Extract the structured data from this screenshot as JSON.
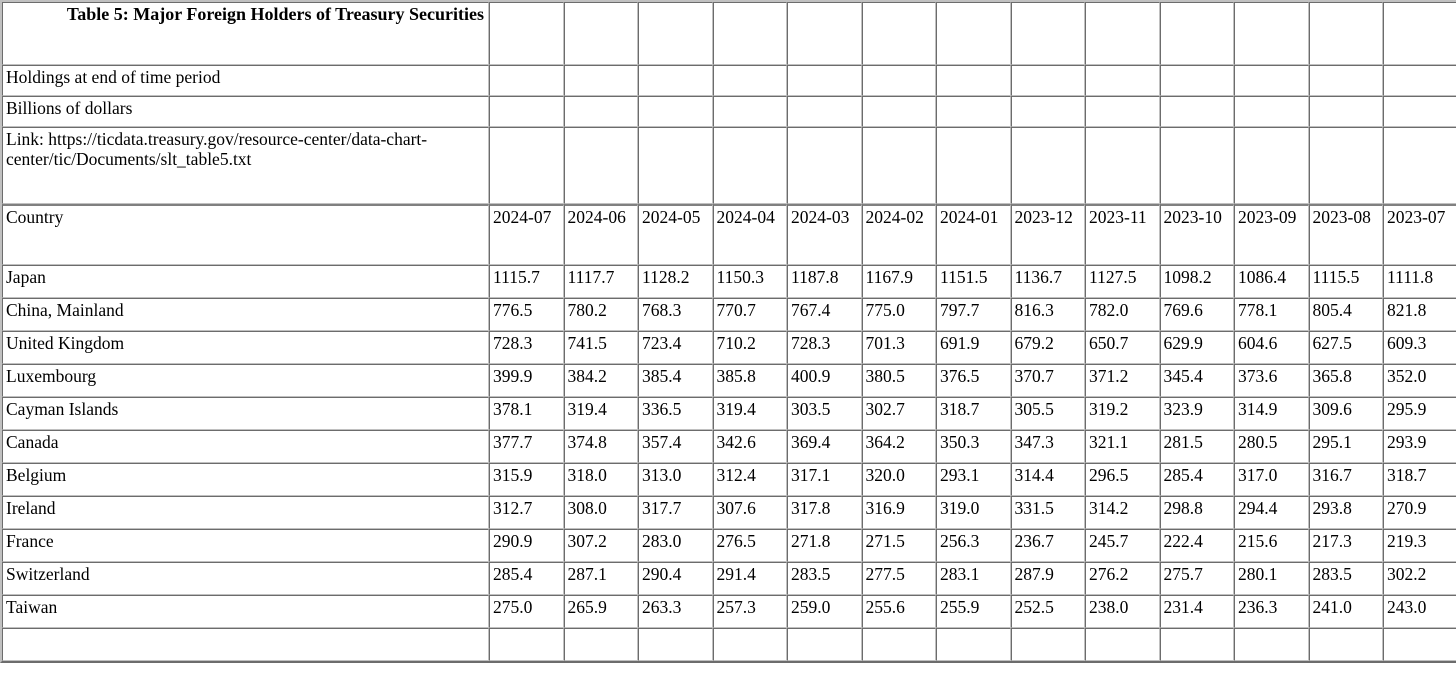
{
  "document": {
    "title": "Table 5: Major Foreign Holders of Treasury Securities",
    "subtitle_1": "Holdings at end of time period",
    "subtitle_2": "Billions of dollars",
    "link_line": "Link: https://ticdata.treasury.gov/resource-center/data-chart-center/tic/Documents/slt_table5.txt"
  },
  "chart_data": {
    "type": "table",
    "title": "Table 5: Major Foreign Holders of Treasury Securities",
    "subtitle": "Holdings at end of time period",
    "units": "Billions of dollars",
    "source_link": "https://ticdata.treasury.gov/resource-center/data-chart-center/tic/Documents/slt_table5.txt",
    "row_header": "Country",
    "categories": [
      "2024-07",
      "2024-06",
      "2024-05",
      "2024-04",
      "2024-03",
      "2024-02",
      "2024-01",
      "2023-12",
      "2023-11",
      "2023-10",
      "2023-09",
      "2023-08",
      "2023-07"
    ],
    "series": [
      {
        "name": "Japan",
        "values": [
          1115.7,
          1117.7,
          1128.2,
          1150.3,
          1187.8,
          1167.9,
          1151.5,
          1136.7,
          1127.5,
          1098.2,
          1086.4,
          1115.5,
          1111.8
        ]
      },
      {
        "name": "China, Mainland",
        "values": [
          776.5,
          780.2,
          768.3,
          770.7,
          767.4,
          775.0,
          797.7,
          816.3,
          782.0,
          769.6,
          778.1,
          805.4,
          821.8
        ]
      },
      {
        "name": "United Kingdom",
        "values": [
          728.3,
          741.5,
          723.4,
          710.2,
          728.3,
          701.3,
          691.9,
          679.2,
          650.7,
          629.9,
          604.6,
          627.5,
          609.3
        ]
      },
      {
        "name": "Luxembourg",
        "values": [
          399.9,
          384.2,
          385.4,
          385.8,
          400.9,
          380.5,
          376.5,
          370.7,
          371.2,
          345.4,
          373.6,
          365.8,
          352.0
        ]
      },
      {
        "name": "Cayman Islands",
        "values": [
          378.1,
          319.4,
          336.5,
          319.4,
          303.5,
          302.7,
          318.7,
          305.5,
          319.2,
          323.9,
          314.9,
          309.6,
          295.9
        ]
      },
      {
        "name": "Canada",
        "values": [
          377.7,
          374.8,
          357.4,
          342.6,
          369.4,
          364.2,
          350.3,
          347.3,
          321.1,
          281.5,
          280.5,
          295.1,
          293.9
        ]
      },
      {
        "name": "Belgium",
        "values": [
          315.9,
          318.0,
          313.0,
          312.4,
          317.1,
          320.0,
          293.1,
          314.4,
          296.5,
          285.4,
          317.0,
          316.7,
          318.7
        ]
      },
      {
        "name": "Ireland",
        "values": [
          312.7,
          308.0,
          317.7,
          307.6,
          317.8,
          316.9,
          319.0,
          331.5,
          314.2,
          298.8,
          294.4,
          293.8,
          270.9
        ]
      },
      {
        "name": "France",
        "values": [
          290.9,
          307.2,
          283.0,
          276.5,
          271.8,
          271.5,
          256.3,
          236.7,
          245.7,
          222.4,
          215.6,
          217.3,
          219.3
        ]
      },
      {
        "name": "Switzerland",
        "values": [
          285.4,
          287.1,
          290.4,
          291.4,
          283.5,
          277.5,
          283.1,
          287.9,
          276.2,
          275.7,
          280.1,
          283.5,
          302.2
        ]
      },
      {
        "name": "Taiwan",
        "values": [
          275.0,
          265.9,
          263.3,
          257.3,
          259.0,
          255.6,
          255.9,
          252.5,
          238.0,
          231.4,
          236.3,
          241.0,
          243.0
        ]
      }
    ],
    "ylabel": "Billions of dollars",
    "xlabel": "",
    "grid": true,
    "legend": "none"
  },
  "columns": {
    "row_header": "Country",
    "months": [
      "2024-07",
      "2024-06",
      "2024-05",
      "2024-04",
      "2024-03",
      "2024-02",
      "2024-01",
      "2023-12",
      "2023-11",
      "2023-10",
      "2023-09",
      "2023-08",
      "2023-07"
    ]
  },
  "rows": [
    {
      "country": "Japan",
      "values": [
        "1115.7",
        "1117.7",
        "1128.2",
        "1150.3",
        "1187.8",
        "1167.9",
        "1151.5",
        "1136.7",
        "1127.5",
        "1098.2",
        "1086.4",
        "1115.5",
        "1111.8"
      ]
    },
    {
      "country": "China, Mainland",
      "values": [
        "776.5",
        "780.2",
        "768.3",
        "770.7",
        "767.4",
        "775.0",
        "797.7",
        "816.3",
        "782.0",
        "769.6",
        "778.1",
        "805.4",
        "821.8"
      ]
    },
    {
      "country": "United Kingdom",
      "values": [
        "728.3",
        "741.5",
        "723.4",
        "710.2",
        "728.3",
        "701.3",
        "691.9",
        "679.2",
        "650.7",
        "629.9",
        "604.6",
        "627.5",
        "609.3"
      ]
    },
    {
      "country": "Luxembourg",
      "values": [
        "399.9",
        "384.2",
        "385.4",
        "385.8",
        "400.9",
        "380.5",
        "376.5",
        "370.7",
        "371.2",
        "345.4",
        "373.6",
        "365.8",
        "352.0"
      ]
    },
    {
      "country": "Cayman Islands",
      "values": [
        "378.1",
        "319.4",
        "336.5",
        "319.4",
        "303.5",
        "302.7",
        "318.7",
        "305.5",
        "319.2",
        "323.9",
        "314.9",
        "309.6",
        "295.9"
      ]
    },
    {
      "country": "Canada",
      "values": [
        "377.7",
        "374.8",
        "357.4",
        "342.6",
        "369.4",
        "364.2",
        "350.3",
        "347.3",
        "321.1",
        "281.5",
        "280.5",
        "295.1",
        "293.9"
      ]
    },
    {
      "country": "Belgium",
      "values": [
        "315.9",
        "318.0",
        "313.0",
        "312.4",
        "317.1",
        "320.0",
        "293.1",
        "314.4",
        "296.5",
        "285.4",
        "317.0",
        "316.7",
        "318.7"
      ]
    },
    {
      "country": "Ireland",
      "values": [
        "312.7",
        "308.0",
        "317.7",
        "307.6",
        "317.8",
        "316.9",
        "319.0",
        "331.5",
        "314.2",
        "298.8",
        "294.4",
        "293.8",
        "270.9"
      ]
    },
    {
      "country": "France",
      "values": [
        "290.9",
        "307.2",
        "283.0",
        "276.5",
        "271.8",
        "271.5",
        "256.3",
        "236.7",
        "245.7",
        "222.4",
        "215.6",
        "217.3",
        "219.3"
      ]
    },
    {
      "country": "Switzerland",
      "values": [
        "285.4",
        "287.1",
        "290.4",
        "291.4",
        "283.5",
        "277.5",
        "283.1",
        "287.9",
        "276.2",
        "275.7",
        "280.1",
        "283.5",
        "302.2"
      ]
    },
    {
      "country": "Taiwan",
      "values": [
        "275.0",
        "265.9",
        "263.3",
        "257.3",
        "259.0",
        "255.6",
        "255.9",
        "252.5",
        "238.0",
        "231.4",
        "236.3",
        "241.0",
        "243.0"
      ]
    },
    {
      "country": "",
      "values": [
        "",
        "",
        "",
        "",
        "",
        "",
        "",
        "",
        "",
        "",
        "",
        "",
        ""
      ]
    }
  ]
}
